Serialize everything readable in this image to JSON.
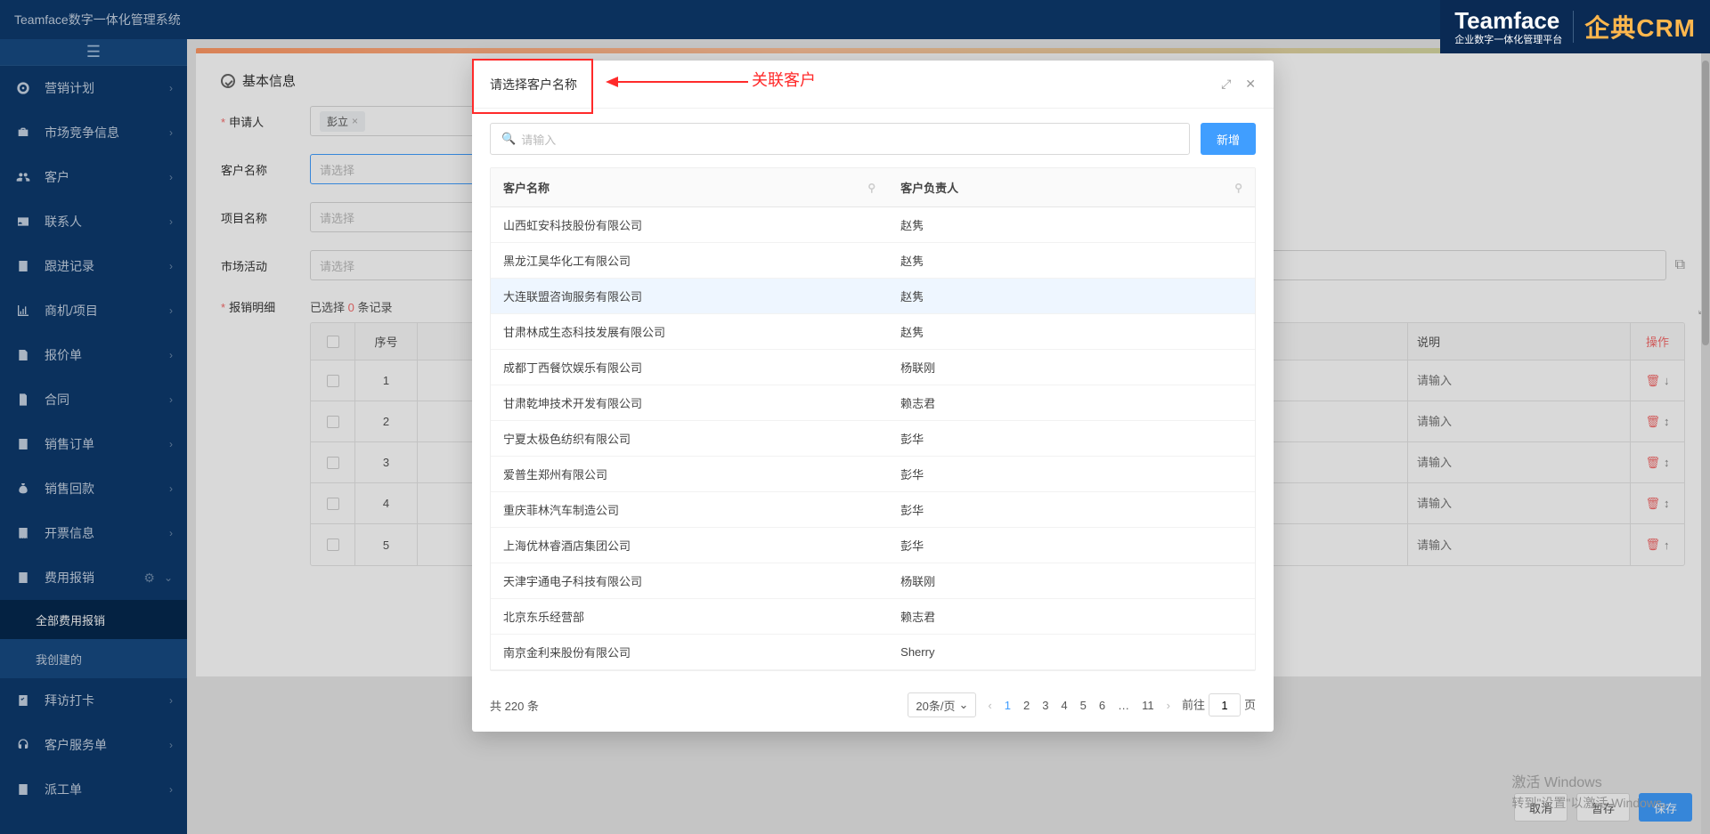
{
  "app": {
    "title": "Teamface数字一体化管理系统"
  },
  "page": {
    "title": "费用报销"
  },
  "sidebar": {
    "items": [
      {
        "label": "营销计划"
      },
      {
        "label": "市场竞争信息"
      },
      {
        "label": "客户"
      },
      {
        "label": "联系人"
      },
      {
        "label": "跟进记录"
      },
      {
        "label": "商机/项目"
      },
      {
        "label": "报价单"
      },
      {
        "label": "合同"
      },
      {
        "label": "销售订单"
      },
      {
        "label": "销售回款"
      },
      {
        "label": "开票信息"
      },
      {
        "label": "费用报销"
      },
      {
        "label": "拜访打卡"
      },
      {
        "label": "客户服务单"
      },
      {
        "label": "派工单"
      }
    ],
    "sub": [
      {
        "label": "全部费用报销"
      },
      {
        "label": "我创建的"
      }
    ]
  },
  "form": {
    "section": "基本信息",
    "fields": {
      "applicant_label": "申请人",
      "applicant_value": "彭立",
      "customer_label": "客户名称",
      "customer_ph": "请选择",
      "project_label": "项目名称",
      "project_ph": "请选择",
      "market_label": "市场活动",
      "market_ph": "请选择",
      "detail_label": "报销明细"
    },
    "selected_prefix": "已选择 ",
    "selected_count": "0",
    "selected_suffix": " 条记录",
    "grid": {
      "head": {
        "idx": "序号",
        "desc": "说明",
        "act": "操作"
      },
      "desc_ph": "请输入",
      "rows": [
        "1",
        "2",
        "3",
        "4",
        "5"
      ]
    }
  },
  "modal": {
    "title": "请选择客户名称",
    "search_ph": "请输入",
    "add_btn": "新增",
    "cols": {
      "name": "客户名称",
      "owner": "客户负责人"
    },
    "rows": [
      {
        "name": "山西虹安科技股份有限公司",
        "owner": "赵隽"
      },
      {
        "name": "黑龙江昊华化工有限公司",
        "owner": "赵隽"
      },
      {
        "name": "大连联盟咨询服务有限公司",
        "owner": "赵隽"
      },
      {
        "name": "甘肃林成生态科技发展有限公司",
        "owner": "赵隽"
      },
      {
        "name": "成都丁西餐饮娱乐有限公司",
        "owner": "杨联刚"
      },
      {
        "name": "甘肃乾坤技术开发有限公司",
        "owner": "赖志君"
      },
      {
        "name": "宁夏太极色纺织有限公司",
        "owner": "彭华"
      },
      {
        "name": "爱普生郑州有限公司",
        "owner": "彭华"
      },
      {
        "name": "重庆菲林汽车制造公司",
        "owner": "彭华"
      },
      {
        "name": "上海优林睿酒店集团公司",
        "owner": "彭华"
      },
      {
        "name": "天津宇通电子科技有限公司",
        "owner": "杨联刚"
      },
      {
        "name": "北京东乐经营部",
        "owner": "赖志君"
      },
      {
        "name": "南京金利来股份有限公司",
        "owner": "Sherry"
      }
    ],
    "pager": {
      "total_prefix": "共 ",
      "total": "220",
      "total_suffix": " 条",
      "size": "20条/页",
      "pages": [
        "1",
        "2",
        "3",
        "4",
        "5",
        "6",
        "…",
        "11"
      ],
      "jump_prefix": "前往",
      "jump_val": "1",
      "jump_suffix": "页"
    }
  },
  "footer": {
    "cancel": "取消",
    "draft": "暂存",
    "save": "保存"
  },
  "brand": {
    "tf": "Teamface",
    "sub": "企业数字一体化管理平台",
    "crm": "企典CRM"
  },
  "annotation": {
    "label": "关联客户"
  },
  "watermark": {
    "l1": "激活 Windows",
    "l2": "转到\"设置\"以激活 Windows。"
  }
}
